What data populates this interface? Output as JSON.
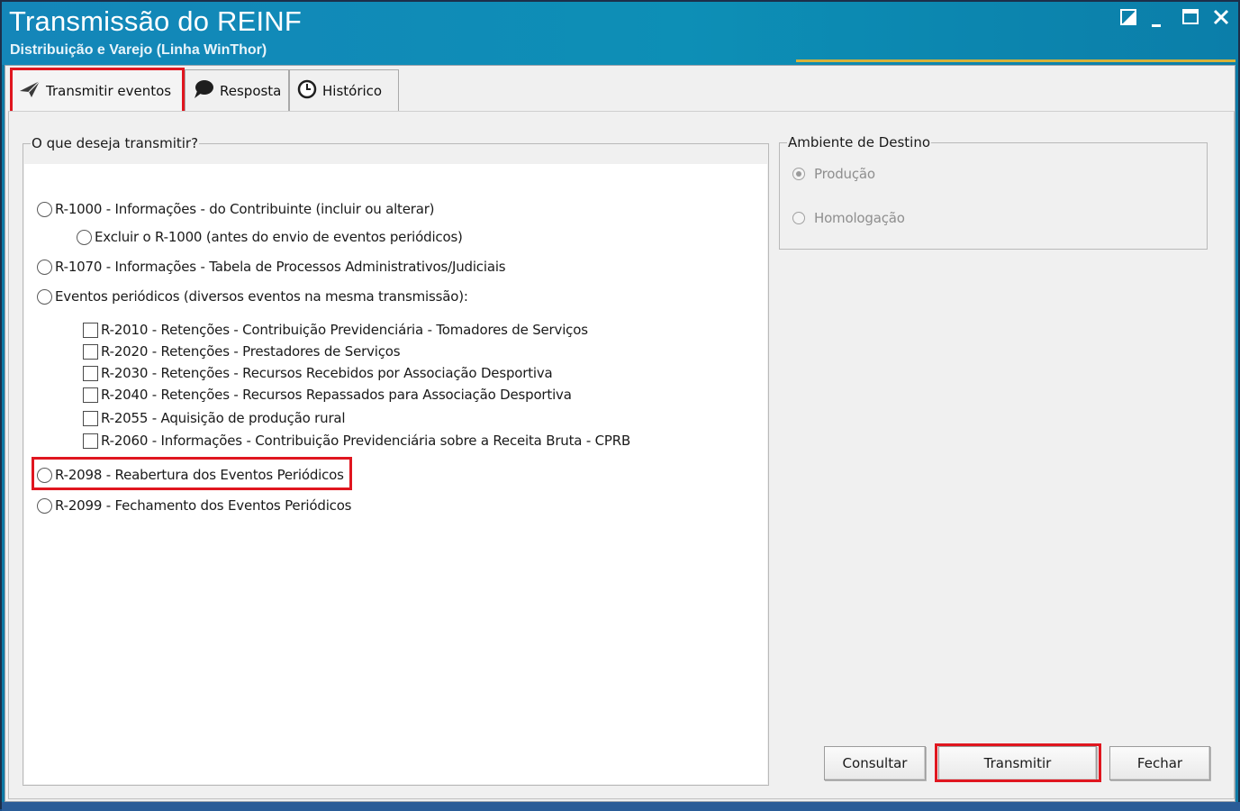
{
  "window": {
    "title": "Transmissão do REINF",
    "subtitle": "Distribuição e Varejo (Linha WinThor)",
    "controls": [
      "restore-icon",
      "minimize-icon",
      "maximize-icon",
      "close-icon"
    ]
  },
  "tabs": [
    {
      "label": "Transmitir eventos",
      "icon": "send-icon",
      "active": true
    },
    {
      "label": "Resposta",
      "icon": "speech-bubble-icon",
      "active": false
    },
    {
      "label": "Histórico",
      "icon": "clock-icon",
      "active": false
    }
  ],
  "transmit_group": {
    "legend": "O que deseja transmitir?",
    "options": {
      "r1000": "R-1000 - Informações - do Contribuinte (incluir ou alterar)",
      "excluir_r1000": "Excluir o R-1000 (antes do envio de eventos periódicos)",
      "r1070": "R-1070 - Informações - Tabela de Processos Administrativos/Judiciais",
      "periodicos": "Eventos periódicos (diversos eventos na mesma transmissão):",
      "r2098": "R-2098 - Reabertura dos Eventos Periódicos",
      "r2099": "R-2099 - Fechamento dos Eventos Periódicos"
    },
    "checkboxes": [
      "R-2010 - Retenções - Contribuição Previdenciária - Tomadores de Serviços",
      "R-2020 - Retenções - Prestadores de Serviços",
      "R-2030 - Retenções - Recursos Recebidos por Associação Desportiva",
      "R-2040 - Retenções - Recursos Repassados para Associação Desportiva",
      "R-2055 - Aquisição de produção rural",
      "R-2060 - Informações - Contribuição Previdenciária sobre a Receita Bruta - CPRB"
    ]
  },
  "ambiente_group": {
    "legend": "Ambiente de Destino",
    "producao": "Produção",
    "homologacao": "Homologação",
    "selected": "Produção"
  },
  "buttons": {
    "consultar": "Consultar",
    "transmitir": "Transmitir",
    "fechar": "Fechar"
  },
  "colors": {
    "titlebar": "#0d8fb6",
    "highlight": "#e0161f",
    "accent": "#d6b23a"
  }
}
